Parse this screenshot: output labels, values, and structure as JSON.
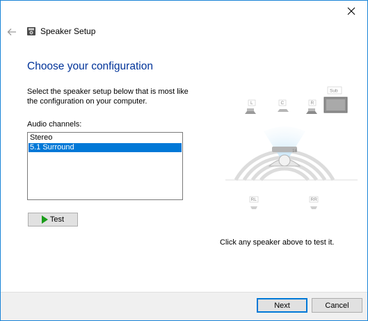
{
  "window": {
    "title": "Speaker Setup"
  },
  "icons": {
    "back": "back-arrow-icon",
    "close": "close-icon",
    "app": "speaker-icon"
  },
  "main": {
    "heading": "Choose your configuration",
    "instructions": "Select the speaker setup below that is most like the configuration on your computer.",
    "channels_label": "Audio channels:",
    "channels": [
      {
        "label": "Stereo",
        "selected": false
      },
      {
        "label": "5.1 Surround",
        "selected": true
      }
    ],
    "test_label": "Test",
    "hint": "Click any speaker above to test it."
  },
  "speakers": {
    "front_left": "L",
    "center": "C",
    "front_right": "R",
    "subwoofer": "Sub",
    "rear_left": "RL",
    "rear_right": "RR"
  },
  "footer": {
    "next_label": "Next",
    "cancel_label": "Cancel"
  },
  "colors": {
    "accent": "#0078d7",
    "heading": "#003399",
    "window_border": "#1883d7"
  }
}
